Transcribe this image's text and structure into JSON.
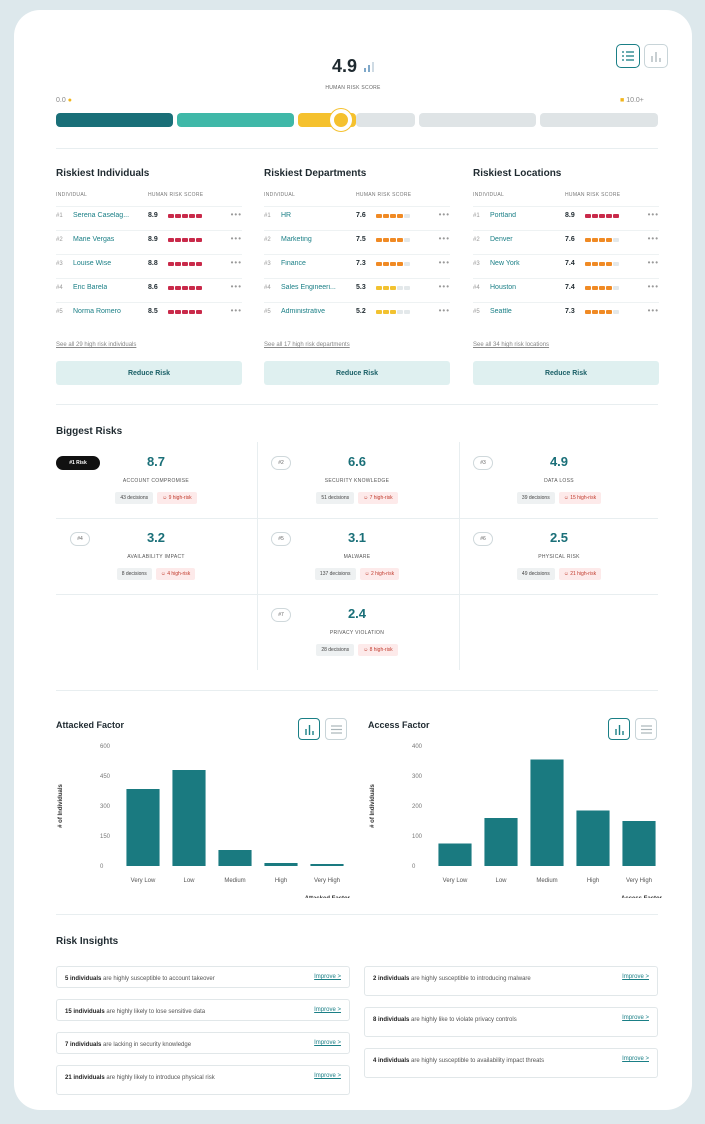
{
  "colors": {
    "teal_dark": "#1a6f78",
    "teal_mid": "#3fb8a8",
    "yellow": "#f5c12e",
    "gray": "#dfe4e6",
    "red_bar": "#c92a4a",
    "orange_bar": "#f08a24",
    "yellow_bar": "#f2c230"
  },
  "header": {
    "score": "4.9",
    "score_label": "HUMAN RISK SCORE",
    "scale_min": "0.0",
    "scale_max": "10.0+",
    "scale_value": 4.9
  },
  "individuals": {
    "title": "Riskiest Individuals",
    "col1": "INDIVIDUAL",
    "col2": "HUMAN RISK SCORE",
    "rows": [
      {
        "rank": "#1",
        "name": "Serena Caselag...",
        "score": "8.9",
        "level": "red",
        "filled": 5
      },
      {
        "rank": "#2",
        "name": "Marie Vergas",
        "score": "8.9",
        "level": "red",
        "filled": 5
      },
      {
        "rank": "#3",
        "name": "Louise Wise",
        "score": "8.8",
        "level": "red",
        "filled": 5
      },
      {
        "rank": "#4",
        "name": "Eric Barela",
        "score": "8.6",
        "level": "red",
        "filled": 5
      },
      {
        "rank": "#5",
        "name": "Norma Romero",
        "score": "8.5",
        "level": "red",
        "filled": 5
      }
    ],
    "see_all": "See all 29 high risk individuals",
    "button": "Reduce Risk"
  },
  "departments": {
    "title": "Riskiest Departments",
    "col1": "INDIVIDUAL",
    "col2": "HUMAN RISK SCORE",
    "rows": [
      {
        "rank": "#1",
        "name": "HR",
        "score": "7.6",
        "level": "orange",
        "filled": 4
      },
      {
        "rank": "#2",
        "name": "Marketing",
        "score": "7.5",
        "level": "orange",
        "filled": 4
      },
      {
        "rank": "#3",
        "name": "Finance",
        "score": "7.3",
        "level": "orange",
        "filled": 4
      },
      {
        "rank": "#4",
        "name": "Sales Engineeri...",
        "score": "5.3",
        "level": "yellow",
        "filled": 3
      },
      {
        "rank": "#5",
        "name": "Administrative",
        "score": "5.2",
        "level": "yellow",
        "filled": 3
      }
    ],
    "see_all": "See all 17 high risk departments",
    "button": "Reduce Risk"
  },
  "locations": {
    "title": "Riskiest Locations",
    "col1": "INDIVIDUAL",
    "col2": "HUMAN RISK SCORE",
    "rows": [
      {
        "rank": "#1",
        "name": "Portland",
        "score": "8.9",
        "level": "red",
        "filled": 5
      },
      {
        "rank": "#2",
        "name": "Denver",
        "score": "7.6",
        "level": "orange",
        "filled": 4
      },
      {
        "rank": "#3",
        "name": "New York",
        "score": "7.4",
        "level": "orange",
        "filled": 4
      },
      {
        "rank": "#4",
        "name": "Houston",
        "score": "7.4",
        "level": "orange",
        "filled": 4
      },
      {
        "rank": "#5",
        "name": "Seattle",
        "score": "7.3",
        "level": "orange",
        "filled": 4
      }
    ],
    "see_all": "See all 34 high risk locations",
    "button": "Reduce Risk"
  },
  "biggest_risks": {
    "title": "Biggest Risks",
    "items": [
      {
        "rank": "#1 Risk",
        "value": "8.7",
        "name": "ACCOUNT COMPROMISE",
        "decisions": "43 decisions",
        "high_risk": "9 high-risk"
      },
      {
        "rank": "#2",
        "value": "6.6",
        "name": "SECURITY KNOWLEDGE",
        "decisions": "51 decisions",
        "high_risk": "7 high-risk"
      },
      {
        "rank": "#3",
        "value": "4.9",
        "name": "DATA LOSS",
        "decisions": "39 decisions",
        "high_risk": "15 high-risk"
      },
      {
        "rank": "#4",
        "value": "3.2",
        "name": "AVAILABILITY IMPACT",
        "decisions": "8 decisions",
        "high_risk": "4 high-risk"
      },
      {
        "rank": "#5",
        "value": "3.1",
        "name": "MALWARE",
        "decisions": "137 decisions",
        "high_risk": "2 high-risk"
      },
      {
        "rank": "#6",
        "value": "2.5",
        "name": "PHYSICAL RISK",
        "decisions": "49 decisions",
        "high_risk": "21 high-risk"
      },
      {
        "rank": "#7",
        "value": "2.4",
        "name": "PRIVACY VIOLATION",
        "decisions": "28 decisions",
        "high_risk": "8 high-risk"
      }
    ]
  },
  "chart_data": [
    {
      "type": "bar",
      "title": "Attacked Factor",
      "xlabel": "Attacked Factor",
      "ylabel": "# of Individuals",
      "categories": [
        "Very Low",
        "Low",
        "Medium",
        "High",
        "Very High"
      ],
      "values": [
        385,
        480,
        80,
        15,
        10
      ],
      "ylim": [
        0,
        600
      ],
      "yticks": [
        "600",
        "450",
        "300",
        "150",
        "0"
      ],
      "color": "#1a7a80"
    },
    {
      "type": "bar",
      "title": "Access Factor",
      "xlabel": "Access Factor",
      "ylabel": "# of Individuals",
      "categories": [
        "Very Low",
        "Low",
        "Medium",
        "High",
        "Very High"
      ],
      "values": [
        75,
        160,
        355,
        185,
        150
      ],
      "ylim": [
        0,
        400
      ],
      "yticks": [
        "400",
        "300",
        "200",
        "100",
        "0"
      ],
      "color": "#1a7a80"
    }
  ],
  "insights": {
    "title": "Risk Insights",
    "left": [
      {
        "bold": "5 individuals",
        "text": " are highly susceptible to account takeover",
        "link": "Improve >"
      },
      {
        "bold": "15 individuals",
        "text": " are highly likely to lose sensitive data",
        "link": "Improve >"
      },
      {
        "bold": "7 individuals",
        "text": " are lacking in security knowledge",
        "link": "Improve >"
      },
      {
        "bold": "21 individuals",
        "text": " are highly likely to introduce physical risk",
        "link": "Improve >"
      }
    ],
    "right": [
      {
        "bold": "2 individuals",
        "text": " are highly susceptible to introducing malware",
        "link": "Improve >"
      },
      {
        "bold": "8 individuals",
        "text": " are highly like to violate privacy controls",
        "link": "Improve >"
      },
      {
        "bold": "4 individuals",
        "text": " are highly susceptible to availability impact threats",
        "link": "Improve >"
      }
    ]
  }
}
